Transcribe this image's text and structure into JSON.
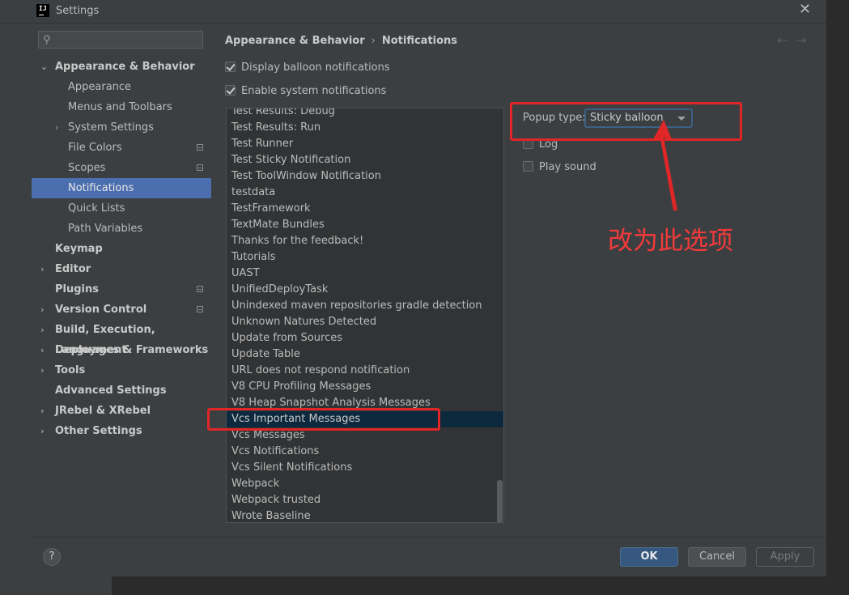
{
  "window": {
    "title": "Settings",
    "logo_text": "IJ"
  },
  "search": {
    "placeholder": "",
    "value": ""
  },
  "sidebar": {
    "items": [
      {
        "label": "Appearance & Behavior",
        "arrow": "⌄"
      },
      {
        "label": "Appearance"
      },
      {
        "label": "Menus and Toolbars"
      },
      {
        "label": "System Settings",
        "arrow": "›"
      },
      {
        "label": "File Colors"
      },
      {
        "label": "Scopes"
      },
      {
        "label": "Notifications"
      },
      {
        "label": "Quick Lists"
      },
      {
        "label": "Path Variables"
      },
      {
        "label": "Keymap"
      },
      {
        "label": "Editor",
        "arrow": "›"
      },
      {
        "label": "Plugins"
      },
      {
        "label": "Version Control",
        "arrow": "›"
      },
      {
        "label": "Build, Execution, Deployment",
        "arrow": "›"
      },
      {
        "label": "Languages & Frameworks",
        "arrow": "›"
      },
      {
        "label": "Tools",
        "arrow": "›"
      },
      {
        "label": "Advanced Settings"
      },
      {
        "label": "JRebel & XRebel",
        "arrow": "›"
      },
      {
        "label": "Other Settings",
        "arrow": "›"
      }
    ]
  },
  "breadcrumb": {
    "parent": "Appearance & Behavior",
    "separator": "›",
    "current": "Notifications"
  },
  "nav": {
    "back": "←",
    "forward": "→"
  },
  "options": {
    "display_balloon": {
      "label": "Display balloon notifications",
      "checked": true
    },
    "enable_system": {
      "label": "Enable system notifications",
      "checked": true
    }
  },
  "groups": [
    "Test Results: Debug",
    "Test Results: Run",
    "Test Runner",
    "Test Sticky Notification",
    "Test ToolWindow Notification",
    "testdata",
    "TestFramework",
    "TextMate Bundles",
    "Thanks for the feedback!",
    "Tutorials",
    "UAST",
    "UnifiedDeployTask",
    "Unindexed maven repositories gradle detection",
    "Unknown Natures Detected",
    "Update from Sources",
    "Update Table",
    "URL does not respond notification",
    "V8 CPU Profiling Messages",
    "V8 Heap Snapshot Analysis Messages",
    "Vcs Important Messages",
    "Vcs Messages",
    "Vcs Notifications",
    "Vcs Silent Notifications",
    "Webpack",
    "Webpack trusted",
    "Wrote Baseline"
  ],
  "selected_group": "Vcs Important Messages",
  "group_settings": {
    "popup_label": "Popup type:",
    "popup_value": "Sticky balloon",
    "log_label": "Log",
    "log_checked": false,
    "play_sound_label": "Play sound",
    "play_sound_checked": false
  },
  "annotation": {
    "text": "改为此选项",
    "color": "#e02626"
  },
  "footer": {
    "help": "?",
    "ok": "OK",
    "cancel": "Cancel",
    "apply": "Apply"
  },
  "colors": {
    "accent": "#4b6eaf",
    "selected_row": "#0d293e",
    "ok_button": "#365880",
    "background": "#3c3f41"
  }
}
